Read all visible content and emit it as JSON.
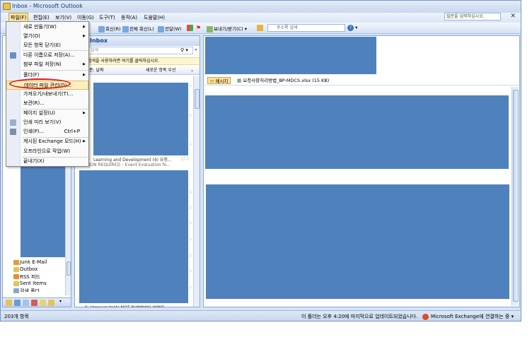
{
  "window": {
    "title": "Inbox - Microsoft Outlook"
  },
  "menubar": {
    "items": [
      "파일(F)",
      "편집(E)",
      "보기(V)",
      "이동(G)",
      "도구(T)",
      "동작(A)",
      "도움말(H)"
    ],
    "help_placeholder": "질문을 입력하십시오."
  },
  "toolbar": {
    "reply": "회신(R)",
    "reply_all": "전체 회신(L)",
    "forward": "전달(W)",
    "send_receive": "보내기/받기(C)",
    "search_placeholder": "주소록 검색"
  },
  "file_menu": {
    "items": [
      {
        "label": "새로 만들기(W)",
        "submenu": true
      },
      {
        "label": "열기(O)",
        "submenu": true
      },
      {
        "label": "모든 항목 닫기(E)"
      },
      {
        "label": "다른 이름으로 저장(A)..."
      },
      {
        "label": "첨부 파일 저장(N)",
        "submenu": true
      },
      {
        "label": "폴더(F)",
        "submenu": true
      },
      {
        "label": "데이터 파일 관리(D)..."
      },
      {
        "label": "가져오기/내보내기(T)..."
      },
      {
        "label": "보관(R)..."
      },
      {
        "label": "페이지 설정(U)",
        "submenu": true
      },
      {
        "label": "인쇄 미리 보기(V)"
      },
      {
        "label": "인쇄(P)...",
        "shortcut": "Ctrl+P"
      },
      {
        "label": "캐시된 Exchange 모드(H)",
        "submenu": true
      },
      {
        "label": "오프라인으로 작업(W)"
      },
      {
        "label": "끝내기(X)"
      }
    ]
  },
  "inbox": {
    "header": "Inbox",
    "search_placeholder": "검색",
    "info_bar": "검색을 사용하려면 여기를 클릭하십시오.",
    "arrange_by": "준: 날짜",
    "sort_order": "새로운 항목 우선",
    "messages": [
      {
        "subject": "Learning and Development (4) 요청...",
        "preview": "TION REQUIRED – Event Evaluation fo..."
      },
      {
        "subject": "S: Vmware tools NOT RUNNING WIND...",
        "preview": ""
      }
    ]
  },
  "nav": {
    "folders": [
      "Junk E-Mail",
      "Outbox",
      "RSS 피드",
      "Sent Items",
      "검색 폴더"
    ]
  },
  "reading": {
    "message_tab": "메시지",
    "attachment": "요청사항처리방법_BP-MDCS.xlsx (15 KB)"
  },
  "status": {
    "item_count": "203개 항목",
    "updated": "이 폴더는 오후 4:20에 마지막으로 업데이트되었습니다.",
    "connection": "Microsoft Exchange에 연결하는 중"
  },
  "colors": {
    "redacted": "#4f81bd",
    "highlight_ring": "#e0141e",
    "menu_highlight": "#fdeec0"
  }
}
